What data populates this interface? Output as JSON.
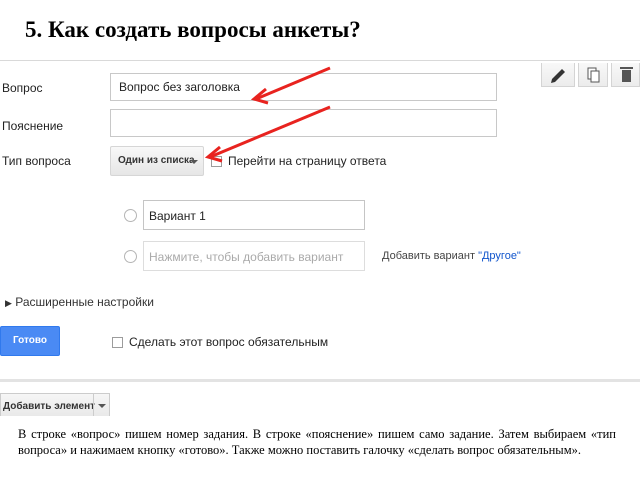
{
  "slide": {
    "title": "5. Как создать вопросы анкеты?",
    "description": "В строке «вопрос» пишем номер задания. В строке «пояснение» пишем само задание. Затем выбираем «тип вопроса» и нажимаем кнопку «готово». Также можно поставить галочку «сделать вопрос обязательным»."
  },
  "form": {
    "question_label": "Вопрос",
    "question_value": "Вопрос без заголовка",
    "hint_label": "Пояснение",
    "hint_value": "",
    "type_label": "Тип вопроса",
    "type_value": "Один из списка",
    "goto_page_label": "Перейти на страницу ответа",
    "option1_value": "Вариант 1",
    "option_add_placeholder": "Нажмите, чтобы добавить вариант",
    "add_option_text": "Добавить вариант",
    "add_other_link": "\"Другое\"",
    "advanced_label": "Расширенные настройки",
    "done_label": "Готово",
    "required_label": "Сделать этот вопрос обязательным",
    "add_item_label": "Добавить элемент"
  },
  "toolbar": {
    "icons": [
      "pencil-icon",
      "copy-icon",
      "delete-icon"
    ]
  },
  "colors": {
    "accent": "#4a8af4",
    "arrow": "#e8231f",
    "link": "#1155cc"
  }
}
